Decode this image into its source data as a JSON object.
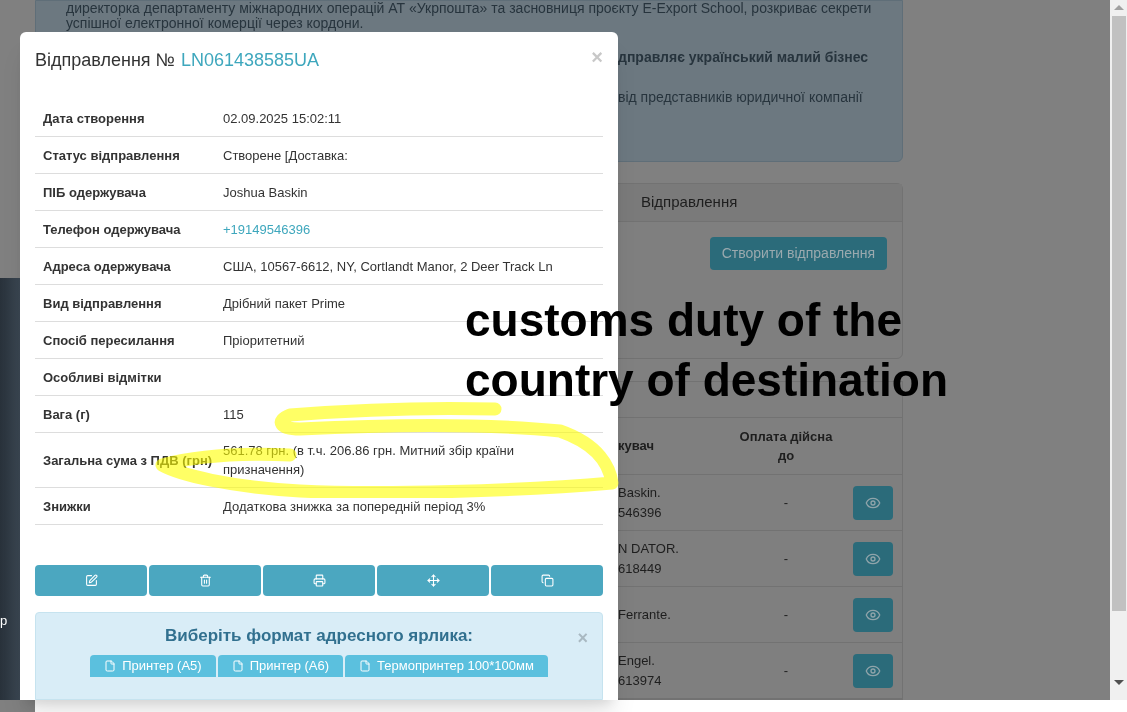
{
  "background": {
    "intro_lines": [
      "директорка департаменту міжнародних операцій АТ «Укрпошта» та засновниця проєкту E-Export School, розкриває секрети",
      "успішної електронної комерції через кордони."
    ],
    "highlight": "дправляє український малий бізнес",
    "note": "від представників юридичної компанії",
    "shipments_panel": {
      "title": "Відправлення",
      "create_button": "Створити відправлення"
    },
    "table": {
      "columns": [
        "кувач",
        "Оплата дійсна до"
      ],
      "rows": [
        {
          "recipient_lines": [
            "Baskin.",
            "546396"
          ],
          "paid_until": "-"
        },
        {
          "recipient_lines": [
            "N DATOR.",
            "618449"
          ],
          "paid_until": "-"
        },
        {
          "recipient_lines": [
            "Ferrante."
          ],
          "paid_until": "-"
        },
        {
          "recipient_lines": [
            "Engel.",
            "613974"
          ],
          "paid_until": "-"
        }
      ]
    },
    "side_panel_text": "р"
  },
  "modal": {
    "title_prefix": "Відправлення №",
    "tracking_number": "LN061438585UA",
    "close": "×",
    "rows": [
      {
        "label": "Дата створення",
        "value": "02.09.2025 15:02:11",
        "kind": "text"
      },
      {
        "label": "Статус відправлення",
        "value": "Створене [Доставка:",
        "kind": "text"
      },
      {
        "label": "ПІБ одержувача",
        "value": "Joshua Baskin",
        "kind": "text"
      },
      {
        "label": "Телефон одержувача",
        "value": "+19149546396",
        "kind": "link"
      },
      {
        "label": "Адреса одержувача",
        "value": "США, 10567-6612, NY, Cortlandt Manor, 2 Deer Track Ln",
        "kind": "text"
      },
      {
        "label": "Вид відправлення",
        "value": "Дрібний пакет Prime",
        "kind": "text"
      },
      {
        "label": "Спосіб пересилання",
        "value": "Пріоритетний",
        "kind": "text"
      },
      {
        "label": "Особливі відмітки",
        "kind": "text"
      },
      {
        "label": "Вага (г)",
        "value": "115",
        "kind": "text"
      },
      {
        "label": "Загальна сума з ПДВ (грн)",
        "value": "561.78 грн. (в т.ч. 206.86 грн. Митний збір країни призначення)",
        "kind": "text"
      },
      {
        "label": "Знижки",
        "value": "Додаткова знижка за попередній період 3%",
        "kind": "text"
      }
    ],
    "label_format": {
      "title": "Виберіть формат адресного ярлика:",
      "close": "×",
      "buttons": [
        "Принтер (А5)",
        "Принтер (А6)",
        "Термопринтер 100*100мм"
      ]
    }
  },
  "annotation": {
    "lines": [
      "customs duty of the",
      "country of destination"
    ]
  }
}
